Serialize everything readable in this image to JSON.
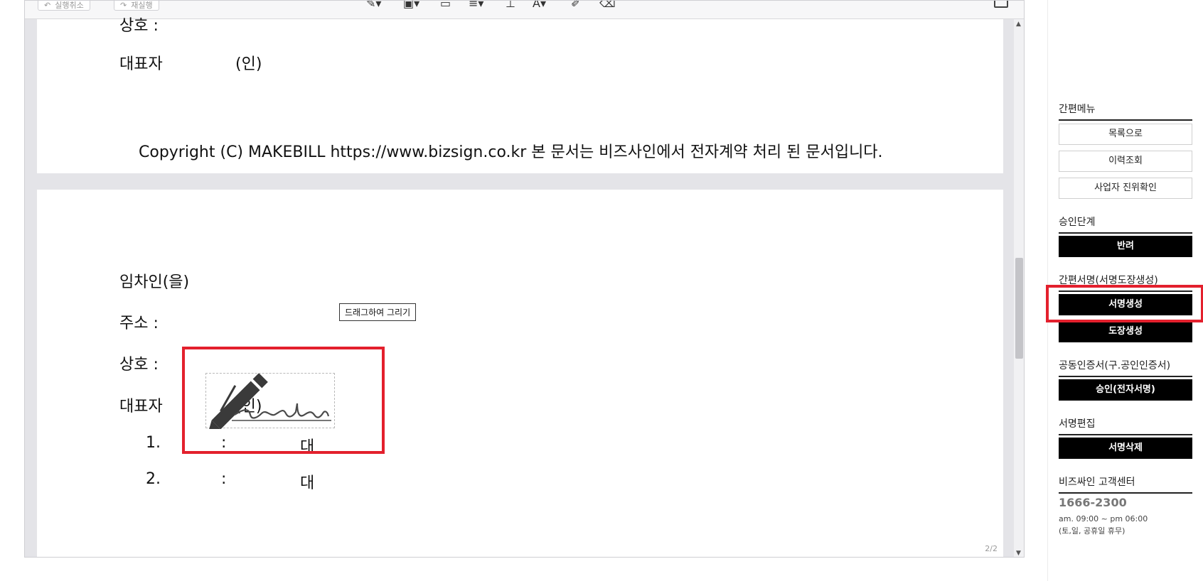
{
  "toolbar": {
    "undo_label": "실행취소",
    "redo_label": "재실행"
  },
  "page1": {
    "company_label": "상호 :",
    "rep_label": "대표자",
    "seal_label": "(인)",
    "copyright": "Copyright (C) MAKEBILL https://www.bizsign.co.kr 본 문서는 비즈사인에서 전자계약 처리 된 문서입니다."
  },
  "page2": {
    "lessee_label": "임차인(을)",
    "address_label": "주소 :",
    "company_label": "상호 :",
    "rep_label": "대표자",
    "seal_label": "(인)",
    "items": [
      {
        "num": "1.",
        "colon": ":",
        "value": "대"
      },
      {
        "num": "2.",
        "colon": ":",
        "value": "대"
      }
    ],
    "tooltip": "드래그하여 그리기",
    "page_indicator": "2/2"
  },
  "side": {
    "quick_menu": {
      "title": "간편메뉴",
      "buttons": [
        "목록으로",
        "이력조회",
        "사업자 진위확인"
      ]
    },
    "approval": {
      "title": "승인단계",
      "reject": "반려"
    },
    "easy_sign": {
      "title": "간편서명(서명도장생성)",
      "create_signature": "서명생성",
      "create_stamp": "도장생성"
    },
    "certificate": {
      "title": "공동인증서(구.공인인증서)",
      "approve": "승인(전자서명)"
    },
    "sign_edit": {
      "title": "서명편집",
      "delete": "서명삭제"
    },
    "support": {
      "title": "비즈싸인 고객센터",
      "phone": "1666-2300",
      "hours": "am. 09:00 ~ pm 06:00",
      "holidays": "(토,일, 공휴일 휴무)"
    }
  },
  "colors": {
    "highlight_red": "#e3202d",
    "button_dark": "#000000"
  }
}
